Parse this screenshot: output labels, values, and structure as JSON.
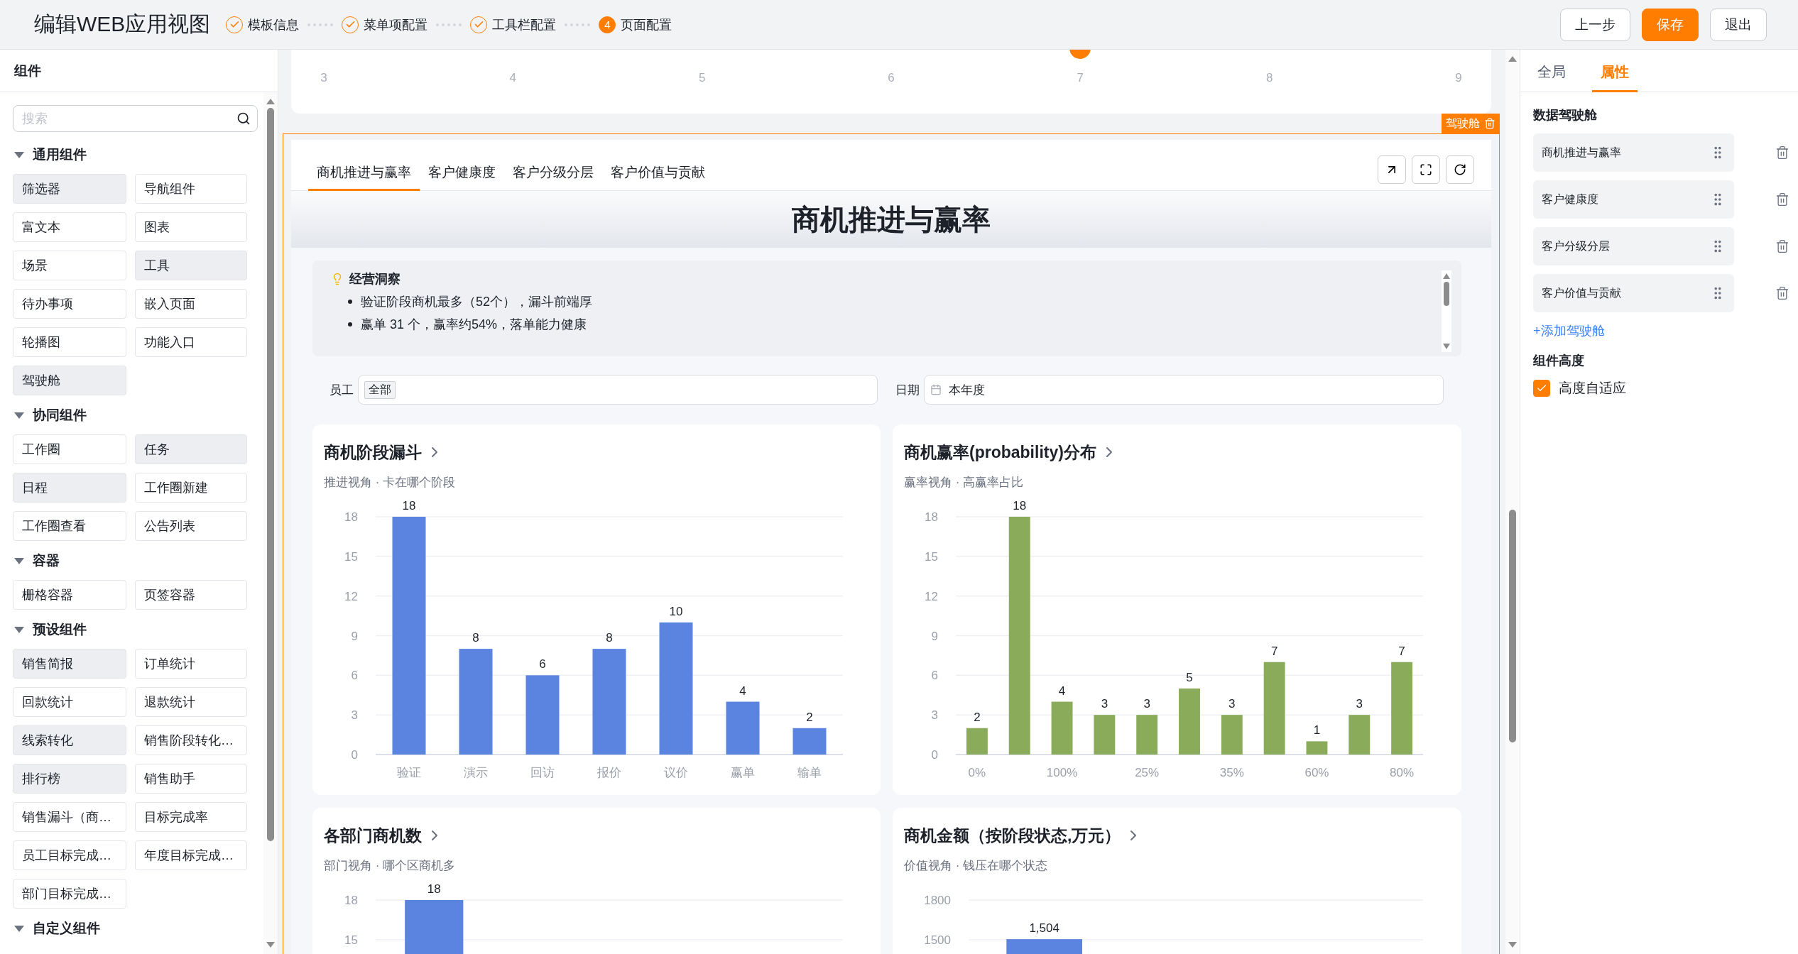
{
  "header": {
    "title": "编辑WEB应用视图",
    "steps": [
      {
        "label": "模板信息",
        "done": true
      },
      {
        "label": "菜单项配置",
        "done": true
      },
      {
        "label": "工具栏配置",
        "done": true
      },
      {
        "label": "页面配置",
        "done": false,
        "number": "4"
      }
    ],
    "buttons": [
      {
        "label": "上一步",
        "kind": "default"
      },
      {
        "label": "保存",
        "kind": "primary"
      },
      {
        "label": "退出",
        "kind": "default"
      }
    ]
  },
  "sidebar": {
    "title": "组件",
    "search": {
      "placeholder": "搜索"
    },
    "sections": [
      {
        "title": "通用组件",
        "expanded": true,
        "items": [
          {
            "label": "筛选器",
            "highlighted": true
          },
          {
            "label": "导航组件",
            "highlighted": false
          },
          {
            "label": "富文本",
            "highlighted": false
          },
          {
            "label": "图表",
            "highlighted": false
          },
          {
            "label": "场景",
            "highlighted": false
          },
          {
            "label": "工具",
            "highlighted": true
          },
          {
            "label": "待办事项",
            "highlighted": false
          },
          {
            "label": "嵌入页面",
            "highlighted": false
          },
          {
            "label": "轮播图",
            "highlighted": false
          },
          {
            "label": "功能入口",
            "highlighted": false
          },
          {
            "label": "驾驶舱",
            "highlighted": true
          }
        ]
      },
      {
        "title": "协同组件",
        "expanded": true,
        "items": [
          {
            "label": "工作圈",
            "highlighted": false
          },
          {
            "label": "任务",
            "highlighted": true
          },
          {
            "label": "日程",
            "highlighted": true
          },
          {
            "label": "工作圈新建",
            "highlighted": false
          },
          {
            "label": "工作圈查看",
            "highlighted": false
          },
          {
            "label": "公告列表",
            "highlighted": false
          }
        ]
      },
      {
        "title": "容器",
        "expanded": true,
        "items": [
          {
            "label": "栅格容器",
            "highlighted": false
          },
          {
            "label": "页签容器",
            "highlighted": false
          }
        ]
      },
      {
        "title": "预设组件",
        "expanded": true,
        "items": [
          {
            "label": "销售简报",
            "highlighted": true
          },
          {
            "label": "订单统计",
            "highlighted": false
          },
          {
            "label": "回款统计",
            "highlighted": false
          },
          {
            "label": "退款统计",
            "highlighted": false
          },
          {
            "label": "线索转化",
            "highlighted": true
          },
          {
            "label": "销售阶段转化…",
            "highlighted": false
          },
          {
            "label": "排行榜",
            "highlighted": true
          },
          {
            "label": "销售助手",
            "highlighted": false
          },
          {
            "label": "销售漏斗（商…",
            "highlighted": false
          },
          {
            "label": "目标完成率",
            "highlighted": false
          },
          {
            "label": "员工目标完成…",
            "highlighted": false
          },
          {
            "label": "年度目标完成…",
            "highlighted": false
          },
          {
            "label": "部门目标完成…",
            "highlighted": false
          }
        ]
      },
      {
        "title": "自定义组件",
        "expanded": true
      }
    ]
  },
  "canvas": {
    "timeline": [
      {
        "label": "3",
        "selected": false
      },
      {
        "label": "4",
        "selected": false
      },
      {
        "label": "5",
        "selected": false
      },
      {
        "label": "6",
        "selected": false
      },
      {
        "label": "7",
        "selected": true
      },
      {
        "label": "8",
        "selected": false
      },
      {
        "label": "9",
        "selected": false
      }
    ],
    "cockpit": {
      "badge": "驾驶舱",
      "tabs": [
        {
          "label": "商机推进与赢率",
          "selected": true
        },
        {
          "label": "客户健康度",
          "selected": false
        },
        {
          "label": "客户分级分层",
          "selected": false
        },
        {
          "label": "客户价值与贡献",
          "selected": false
        }
      ],
      "title": "商机推进与赢率",
      "insight": {
        "title": "经营洞察",
        "bullets": [
          "验证阶段商机最多（52个），漏斗前端厚",
          "赢单 31 个，赢率约54%，落单能力健康"
        ]
      },
      "filters": [
        {
          "label": "员工",
          "kind": "tag",
          "value": "全部"
        },
        {
          "label": "日期",
          "kind": "date",
          "value": "本年度"
        }
      ],
      "cards": [
        {
          "title": "商机阶段漏斗",
          "subtitle": "推进视角 · 卡在哪个阶段",
          "chart_data": {
            "type": "bar",
            "categories": [
              "验证",
              "演示",
              "回访",
              "报价",
              "议价",
              "赢单",
              "输单"
            ],
            "series": [
              {
                "color": "#5b84e0",
                "values": [
                  18,
                  8,
                  6,
                  8,
                  10,
                  4,
                  2
                ]
              }
            ],
            "ylim": [
              0,
              18
            ],
            "yticks": [
              0,
              3,
              6,
              9,
              12,
              15,
              18
            ],
            "grid": true,
            "data_labels": true
          }
        },
        {
          "title": "商机赢率(probability)分布",
          "subtitle": "赢率视角 · 高赢率占比",
          "chart_data": {
            "type": "bar",
            "categories": [
              "0%",
              null,
              "100%",
              null,
              "25%",
              null,
              "35%",
              null,
              "60%",
              null,
              "80%"
            ],
            "series": [
              {
                "color": "#8aac5a",
                "values": [
                  2,
                  18,
                  4,
                  3,
                  3,
                  5,
                  3,
                  7,
                  1,
                  3,
                  7
                ]
              }
            ],
            "ylim": [
              0,
              18
            ],
            "yticks": [
              0,
              3,
              6,
              9,
              12,
              15,
              18
            ],
            "grid": true,
            "data_labels": true
          }
        },
        {
          "title": "各部门商机数",
          "subtitle": "部门视角 · 哪个区商机多",
          "chart_data": {
            "type": "bar",
            "series": [
              {
                "color": "#5b84e0",
                "values": [
                  18,
                  null,
                  null,
                  null
                ]
              }
            ],
            "ylim": [
              0,
              18
            ],
            "yticks": [
              15,
              18
            ],
            "grid": true,
            "data_labels": true
          }
        },
        {
          "title": "商机金额（按阶段状态,万元）",
          "subtitle": "价值视角 · 钱压在哪个状态",
          "chart_data": {
            "type": "bar",
            "series": [
              {
                "color": "#5b84e0",
                "values": [
                  1504,
                  null,
                  null
                ]
              }
            ],
            "ylim": [
              0,
              1800
            ],
            "yticks": [
              1500,
              1800
            ],
            "grid": true,
            "value_labels": [
              "1,504",
              null,
              null
            ]
          }
        }
      ]
    }
  },
  "properties": {
    "tabs": [
      {
        "label": "全局",
        "selected": false
      },
      {
        "label": "属性",
        "selected": true
      }
    ],
    "section_title": "数据驾驶舱",
    "cockpits": [
      "商机推进与赢率",
      "客户健康度",
      "客户分级分层",
      "客户价值与贡献"
    ],
    "add_link": "+添加驾驶舱",
    "height_title": "组件高度",
    "auto_height": {
      "label": "高度自适应",
      "checked": true
    }
  }
}
